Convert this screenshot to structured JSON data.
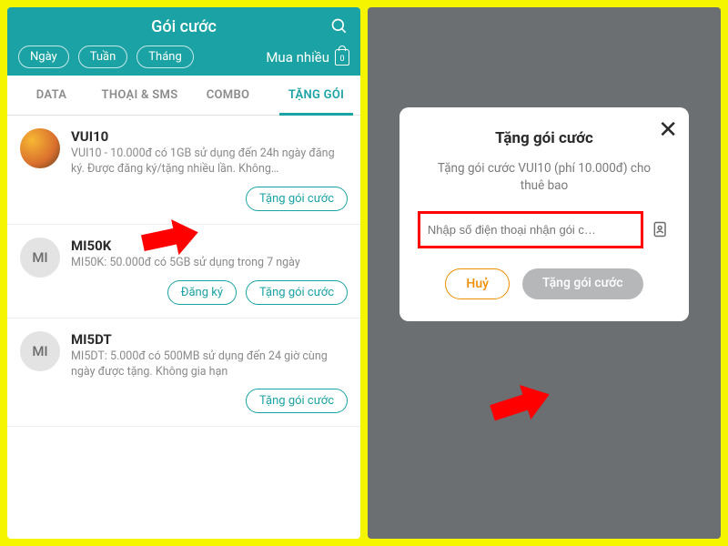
{
  "left": {
    "header": {
      "title": "Gói cước",
      "chips": [
        "Ngày",
        "Tuần",
        "Tháng"
      ],
      "mua_label": "Mua nhiều",
      "bag_count": "0"
    },
    "tabs": [
      "DATA",
      "THOẠI & SMS",
      "COMBO",
      "TẶNG GÓI"
    ],
    "active_tab": 3,
    "items": [
      {
        "avatar_text": "",
        "avatar_img": true,
        "title": "VUI10",
        "desc": "VUI10 - 10.000đ có 1GB sử dụng đến 24h ngày đăng ký. Được đăng ký/tặng nhiều lần. Không…",
        "actions": [
          "Tặng gói cước"
        ]
      },
      {
        "avatar_text": "MI",
        "avatar_img": false,
        "title": "MI50K",
        "desc": "MI50K: 50.000đ có 5GB sử dụng trong 7 ngày",
        "actions": [
          "Đăng ký",
          "Tặng gói cước"
        ]
      },
      {
        "avatar_text": "MI",
        "avatar_img": false,
        "title": "MI5DT",
        "desc": "MI5DT: 5.000đ có 500MB sử dụng đến 24 giờ cùng ngày được tặng. Không gia hạn",
        "actions": [
          "Tặng gói cước"
        ]
      }
    ]
  },
  "modal": {
    "title": "Tặng gói cước",
    "subtitle": "Tặng gói cước VUI10 (phí 10.000đ) cho thuê bao",
    "placeholder": "Nhập số điện thoại nhận gói c…",
    "cancel": "Huỷ",
    "confirm": "Tặng gói cước"
  }
}
